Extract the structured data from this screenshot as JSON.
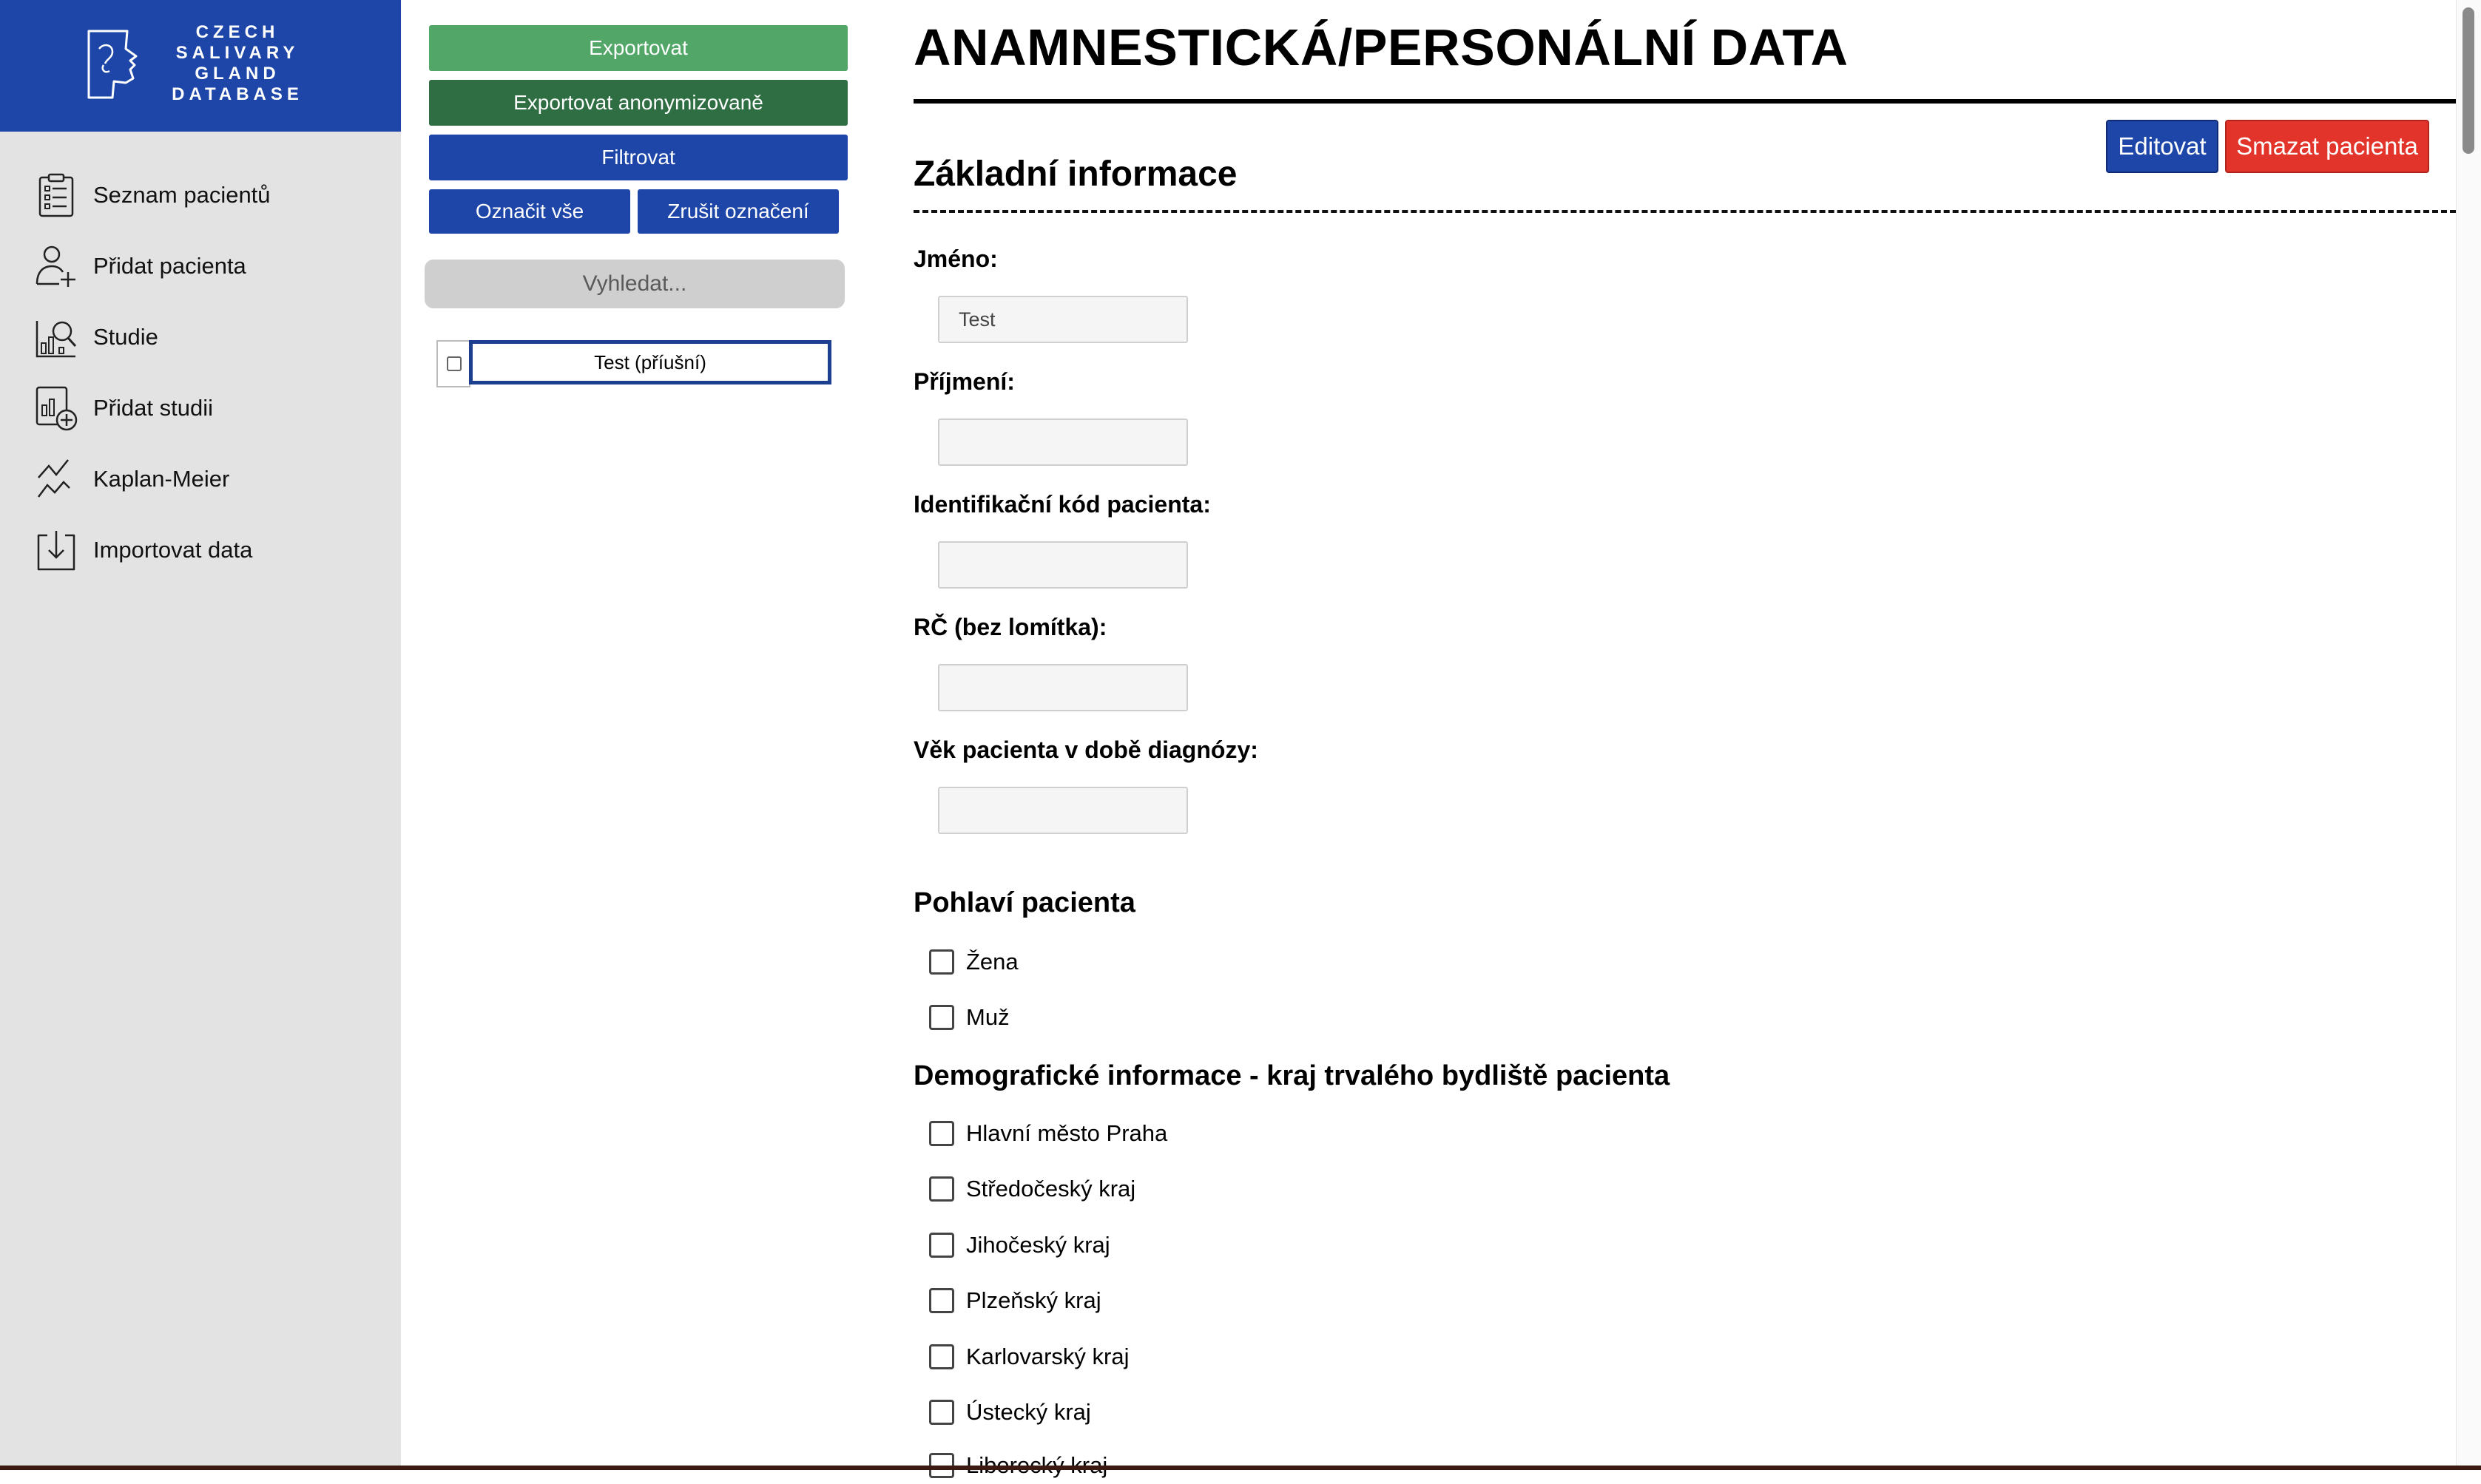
{
  "brand": {
    "lines": [
      "CZECH",
      "SALIVARY",
      "GLAND",
      "DATABASE"
    ],
    "color": "#1d46a8"
  },
  "sidebar": {
    "items": [
      {
        "label": "Seznam pacientů",
        "icon": "clipboard-list-icon"
      },
      {
        "label": "Přidat pacienta",
        "icon": "add-user-icon"
      },
      {
        "label": "Studie",
        "icon": "study-search-icon"
      },
      {
        "label": "Přidat studii",
        "icon": "add-study-icon"
      },
      {
        "label": "Kaplan-Meier",
        "icon": "survival-curve-icon"
      },
      {
        "label": "Importovat data",
        "icon": "import-icon"
      }
    ]
  },
  "toolbar": {
    "export": "Exportovat",
    "export_anonymized": "Exportovat anonymizovaně",
    "filter": "Filtrovat",
    "select_all": "Označit vše",
    "deselect": "Zrušit označení",
    "search_placeholder": "Vyhledat..."
  },
  "patients": [
    {
      "name": "Test (příušní)",
      "checked": false
    }
  ],
  "main": {
    "title": "ANAMNESTICKÁ/PERSONÁLNÍ DATA",
    "edit": "Editovat",
    "delete": "Smazat pacienta",
    "section_title": "Základní informace",
    "fields": [
      {
        "label": "Jméno:",
        "value": "Test"
      },
      {
        "label": "Příjmení:",
        "value": ""
      },
      {
        "label": "Identifikační kód pacienta:",
        "value": ""
      },
      {
        "label": "RČ (bez lomítka):",
        "value": ""
      },
      {
        "label": "Věk pacienta v době diagnózy:",
        "value": ""
      }
    ],
    "sex": {
      "title": "Pohlaví pacienta",
      "options": [
        "Žena",
        "Muž"
      ]
    },
    "region": {
      "title": "Demografické informace - kraj trvalého bydliště pacienta",
      "options": [
        "Hlavní město Praha",
        "Středočeský kraj",
        "Jihočeský kraj",
        "Plzeňský kraj",
        "Karlovarský kraj",
        "Ústecký kraj",
        "Liberecký kraj"
      ]
    }
  },
  "colors": {
    "primary": "#1d46a8",
    "export": "#52a668",
    "export_anonymized": "#2f6d42",
    "danger": "#e2342b"
  }
}
